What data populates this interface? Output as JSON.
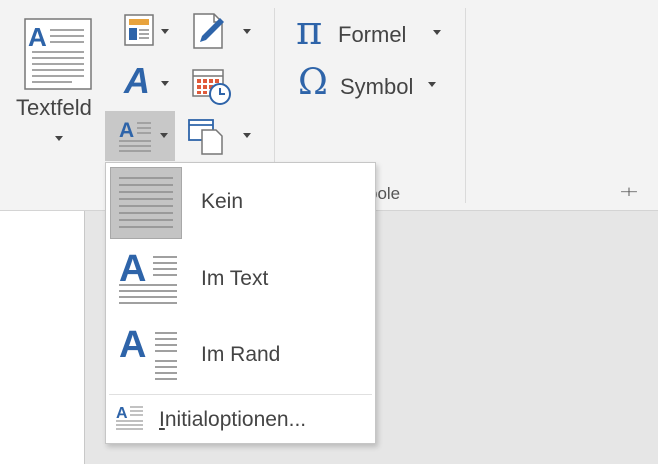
{
  "ribbon": {
    "textbox_label": "Textfeld",
    "formula_label": "Formel",
    "symbol_label": "Symbol",
    "symbols_group_partial": "bole",
    "pin_glyph": "⊣⊢",
    "pi_glyph": "π",
    "omega_glyph": "Ω",
    "a_glyph": "A"
  },
  "dropcap_menu": {
    "items": [
      {
        "label": "Kein",
        "selected": true
      },
      {
        "label": "Im Text",
        "selected": false
      },
      {
        "label": "Im Rand",
        "selected": false
      }
    ],
    "options_first_letter": "I",
    "options_rest": "nitialoptionen..."
  },
  "colors": {
    "accent_blue": "#2e64a9",
    "ribbon_bg": "#f3f3f3",
    "doc_bg": "#e6e6e6",
    "selected_bg": "#c4c4c4"
  }
}
